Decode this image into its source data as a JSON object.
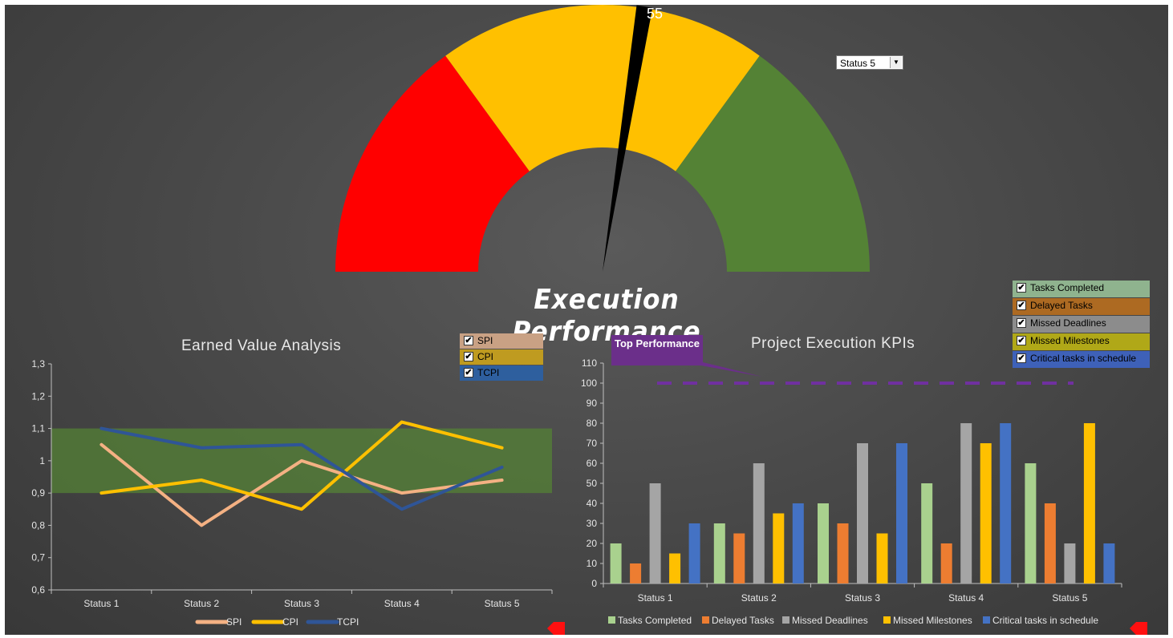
{
  "gauge": {
    "value": 55,
    "value_label": "55",
    "title": "Execution Performance",
    "segments": [
      {
        "from": 0,
        "to": 30,
        "color": "#ff0000"
      },
      {
        "from": 30,
        "to": 70,
        "color": "#ffc000"
      },
      {
        "from": 70,
        "to": 100,
        "color": "#548235"
      }
    ],
    "dropdown_value": "Status 5"
  },
  "colors": {
    "SPI": "#f4b183",
    "CPI": "#ffc000",
    "TCPI": "#2f5597",
    "band": "#548235",
    "Tasks Completed": "#a9d18e",
    "Delayed Tasks": "#ed7d31",
    "Missed Deadlines": "#a5a5a5",
    "Missed Milestones": "#ffc000",
    "Critical tasks in schedule": "#4472c4",
    "target": "#7030a0"
  },
  "ev_checkboxes": [
    {
      "label": "SPI",
      "checked": true,
      "bg": "#c9a184"
    },
    {
      "label": "CPI",
      "checked": true,
      "bg": "#bf9b20"
    },
    {
      "label": "TCPI",
      "checked": true,
      "bg": "#2e5f9e"
    }
  ],
  "kpi_checkboxes": [
    {
      "label": "Tasks Completed",
      "checked": true,
      "bg": "#8fb38e"
    },
    {
      "label": "Delayed Tasks",
      "checked": true,
      "bg": "#ad6a22"
    },
    {
      "label": "Missed Deadlines",
      "checked": true,
      "bg": "#8c8c8c"
    },
    {
      "label": "Missed Milestones",
      "checked": true,
      "bg": "#b0a818"
    },
    {
      "label": "Critical tasks in schedule",
      "checked": true,
      "bg": "#3e61b8"
    }
  ],
  "target_callout": "Top Performance",
  "chart_data": [
    {
      "type": "line",
      "title": "Earned Value Analysis",
      "categories": [
        "Status 1",
        "Status 2",
        "Status 3",
        "Status 4",
        "Status 5"
      ],
      "ylim": [
        0.6,
        1.3
      ],
      "yticks": [
        "0,6",
        "0,7",
        "0,8",
        "0,9",
        "1",
        "1,1",
        "1,2",
        "1,3"
      ],
      "band": [
        0.9,
        1.1
      ],
      "series": [
        {
          "name": "SPI",
          "values": [
            1.05,
            0.8,
            1.0,
            0.9,
            0.94
          ]
        },
        {
          "name": "CPI",
          "values": [
            0.9,
            0.94,
            0.85,
            1.12,
            1.04
          ]
        },
        {
          "name": "TCPI",
          "values": [
            1.1,
            1.04,
            1.05,
            0.85,
            0.98
          ]
        }
      ],
      "legend": "bottom"
    },
    {
      "type": "bar",
      "title": "Project Execution KPIs",
      "categories": [
        "Status 1",
        "Status 2",
        "Status 3",
        "Status 4",
        "Status 5"
      ],
      "ylim": [
        0,
        110
      ],
      "yticks": [
        "0",
        "10",
        "20",
        "30",
        "40",
        "50",
        "60",
        "70",
        "80",
        "90",
        "100",
        "110"
      ],
      "target": 100,
      "series": [
        {
          "name": "Tasks Completed",
          "values": [
            20,
            30,
            40,
            50,
            60
          ]
        },
        {
          "name": "Delayed Tasks",
          "values": [
            10,
            25,
            30,
            20,
            40
          ]
        },
        {
          "name": "Missed Deadlines",
          "values": [
            50,
            60,
            70,
            80,
            20
          ]
        },
        {
          "name": "Missed Milestones",
          "values": [
            15,
            35,
            25,
            70,
            80
          ]
        },
        {
          "name": "Critical tasks in schedule",
          "values": [
            30,
            40,
            70,
            80,
            20
          ]
        }
      ],
      "legend": "bottom"
    }
  ]
}
